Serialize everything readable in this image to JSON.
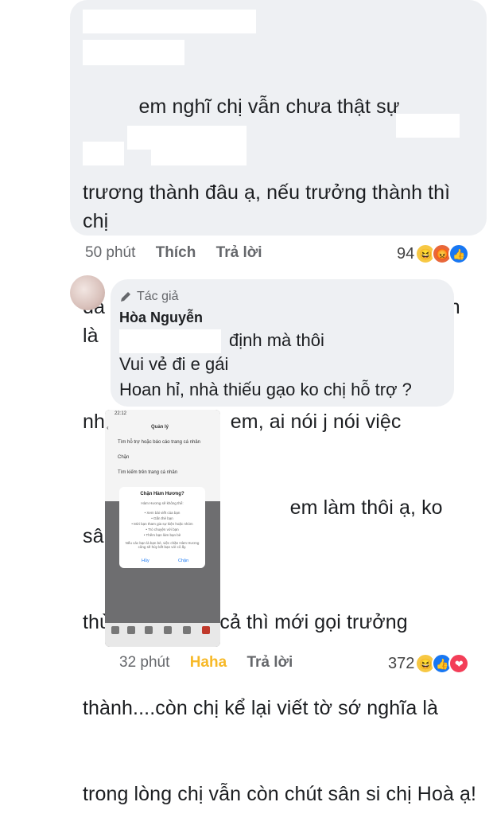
{
  "comment1": {
    "text": "em nghĩ chị vẫn chưa thật sự trương thành đâu ạ, nếu trưởng thành thì chị đã ko sân si kể lại viết tờ sớ, trưởng thành là như em, ai nói j nói việc thì em làm thôi ạ, ko sân si thù hận j với ai cả thì mới gọi trưởng thành....còn chị kể lại viết tờ sớ nghĩa là trong lòng chị vẫn còn chút sân si chị Hoà ạ!",
    "lines": [
      "          em nghĩ chị vẫn chưa thật sự",
      "trương thành đâu ạ, nếu trưởng thành thì chị",
      "đã ko sân si kể lại viết tờ sớ, trưởng thành là",
      "như                    em, ai nói j nói việc",
      "          thì                       em làm thôi ạ, ko sân si",
      "thù hận j với ai cả thì mới gọi trưởng",
      "thành....còn chị kể lại viết tờ sớ nghĩa là",
      "trong lòng chị vẫn còn chút sân si chị Hoà ạ!"
    ],
    "time": "50 phút",
    "like_label": "Thích",
    "reply_label": "Trả lời",
    "reaction_count": "94",
    "reaction_icons": [
      "haha",
      "angry",
      "like"
    ]
  },
  "comment2": {
    "author_badge": "Tác giả",
    "author_name": "Hòa Nguyễn",
    "lines": [
      "định mà thôi",
      "Vui vẻ đi e gái",
      "Hoan hỉ, nhà thiếu gạo ko chị hỗ trợ ?"
    ],
    "time": "32 phút",
    "reaction_label": "Haha",
    "reply_label": "Trả lời",
    "reaction_count": "372",
    "reaction_icons": [
      "haha",
      "like",
      "love"
    ],
    "colors": {
      "haha_label": "#f7b928"
    }
  },
  "screenshot": {
    "status_time": "22:12",
    "header": "Quản lý",
    "menu": [
      "Tìm hỗ trợ hoặc báo cáo trang cá nhân",
      "Chặn",
      "Tìm kiếm trên trang cá nhân"
    ],
    "dialog_title": "Chặn Hàm Hương?",
    "dialog_subtitle": "Hàm Hương sẽ không thể:",
    "dialog_items": [
      "• Xem bài viết của bạn",
      "• Gắn thẻ bạn",
      "• Mời bạn tham gia sự kiện hoặc nhóm",
      "• Trò chuyện với bạn",
      "• Thêm bạn làm bạn bè"
    ],
    "dialog_note": "Nếu các bạn là bạn bè, việc chặn Hàm Hương cũng sẽ hủy kết bạn với cô ấy.",
    "cancel": "Hủy",
    "block": "Chặn"
  }
}
